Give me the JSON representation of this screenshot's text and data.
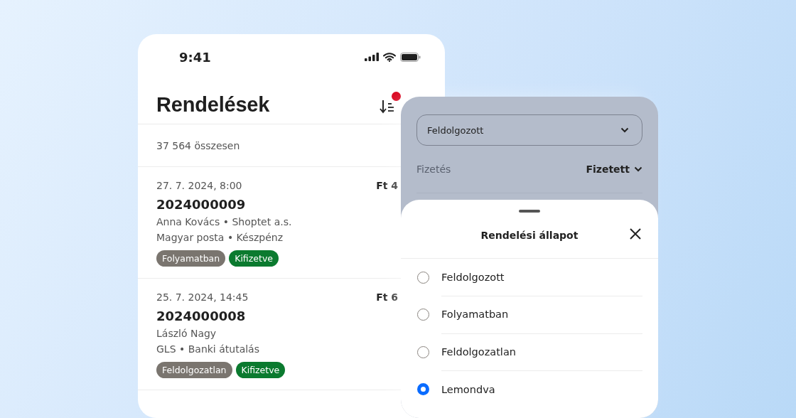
{
  "status_bar": {
    "time": "9:41"
  },
  "header": {
    "title": "Rendelések"
  },
  "summary": "37 564 összesen",
  "orders": [
    {
      "date": "27. 7. 2024, 8:00",
      "amount": "Ft 4",
      "number": "2024000009",
      "lines": [
        "Anna Kovács • Shoptet a.s.",
        "Magyar posta • Készpénz"
      ],
      "tags": [
        {
          "label": "Folyamatban",
          "color": "#7a756f"
        },
        {
          "label": "Kifizetve",
          "color": "#0b7a2f"
        }
      ]
    },
    {
      "date": "25. 7. 2024, 14:45",
      "amount": "Ft 6",
      "number": "2024000008",
      "lines": [
        "László Nagy",
        "GLS • Banki átutalás"
      ],
      "tags": [
        {
          "label": "Feldolgozatlan",
          "color": "#7a756f"
        },
        {
          "label": "Kifizetve",
          "color": "#0b7a2f"
        }
      ]
    }
  ],
  "filter_panel": {
    "select_value": "Feldolgozott",
    "payment": {
      "label": "Fizetés",
      "value": "Fizetett"
    }
  },
  "sheet": {
    "title": "Rendelési állapot",
    "options": [
      {
        "label": "Feldolgozott",
        "selected": false
      },
      {
        "label": "Folyamatban",
        "selected": false
      },
      {
        "label": "Feldolgozatlan",
        "selected": false
      },
      {
        "label": "Lemondva",
        "selected": true
      }
    ]
  }
}
